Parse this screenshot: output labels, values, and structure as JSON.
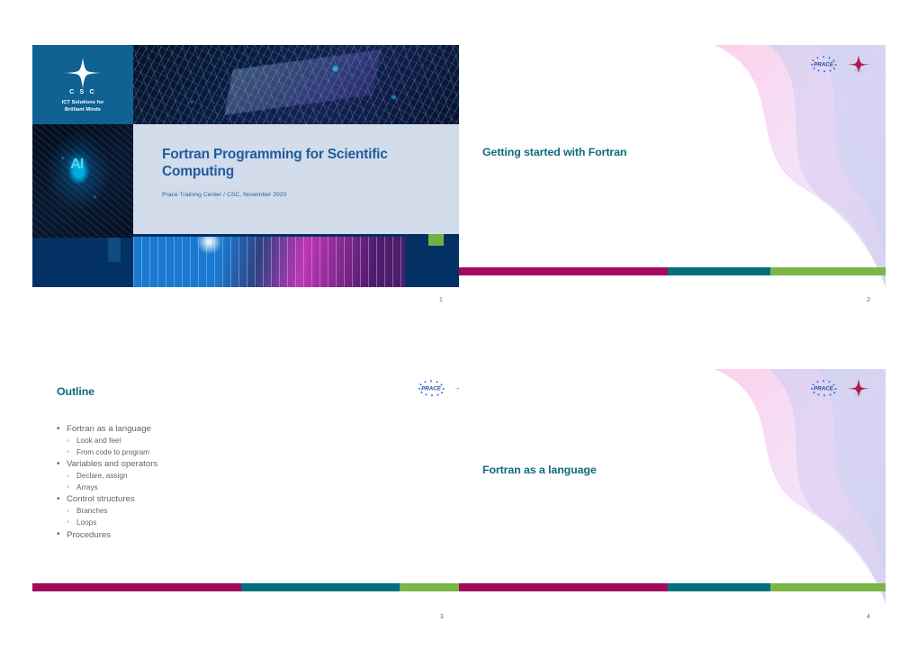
{
  "document": {
    "type": "slide-handout",
    "layout": "2x2",
    "page_background": "#ffffff"
  },
  "brand": {
    "magenta": "#a20a5d",
    "teal": "#00707f",
    "green": "#7ab648",
    "title_teal": "#0d6a7e",
    "title_blue": "#1f5c9e",
    "body_gray": "#5c666f",
    "csc_blue": "#0f6292",
    "navy": "#033164"
  },
  "logos": {
    "csc_mark_name": "csc-star-logo",
    "csc_word": "C S C",
    "csc_tagline_line1": "ICT Solutions for",
    "csc_tagline_line2": "Brilliant Minds",
    "prace_word": "PRACE",
    "csc_small_word": "CSC"
  },
  "slides": [
    {
      "number": "1",
      "kind": "title",
      "title": "Fortran Programming for Scientific Computing",
      "subtitle": "Prace Training Center / CSC, November 2020",
      "images": [
        {
          "name": "circuit-board-photo"
        },
        {
          "name": "ai-head-photo",
          "label": "AI"
        },
        {
          "name": "data-visualization-photo"
        }
      ],
      "accents": [
        {
          "name": "blue-accent-square",
          "color": "#6e9bc8"
        },
        {
          "name": "green-accent-square",
          "color": "#76b045"
        }
      ]
    },
    {
      "number": "2",
      "kind": "section",
      "title": "Getting started with Fortran",
      "colorbar": [
        {
          "name": "magenta-segment",
          "color": "#a20a5d",
          "width_pct": 49
        },
        {
          "name": "teal-segment",
          "color": "#00707f",
          "width_pct": 24
        },
        {
          "name": "green-segment",
          "color": "#7ab648",
          "width_pct": 27
        }
      ]
    },
    {
      "number": "3",
      "kind": "outline",
      "title": "Outline",
      "items": [
        {
          "level": 1,
          "text": "Fortran as a language"
        },
        {
          "level": 2,
          "text": "Look and feel"
        },
        {
          "level": 2,
          "text": "From code to program"
        },
        {
          "level": 1,
          "text": "Variables and operators"
        },
        {
          "level": 2,
          "text": "Declare, assign"
        },
        {
          "level": 2,
          "text": "Arrays"
        },
        {
          "level": 1,
          "text": "Control structures"
        },
        {
          "level": 2,
          "text": "Branches"
        },
        {
          "level": 2,
          "text": "Loops"
        },
        {
          "level": 1,
          "text": "Procedures"
        }
      ],
      "colorbar": [
        {
          "name": "magenta-segment",
          "color": "#a20a5d",
          "width_pct": 49
        },
        {
          "name": "teal-segment",
          "color": "#00707f",
          "width_pct": 37
        },
        {
          "name": "green-segment",
          "color": "#7ab648",
          "width_pct": 14
        }
      ]
    },
    {
      "number": "4",
      "kind": "section",
      "title": "Fortran as a language",
      "colorbar": [
        {
          "name": "magenta-segment",
          "color": "#a20a5d",
          "width_pct": 49
        },
        {
          "name": "teal-segment",
          "color": "#00707f",
          "width_pct": 24
        },
        {
          "name": "green-segment",
          "color": "#7ab648",
          "width_pct": 27
        }
      ]
    }
  ]
}
